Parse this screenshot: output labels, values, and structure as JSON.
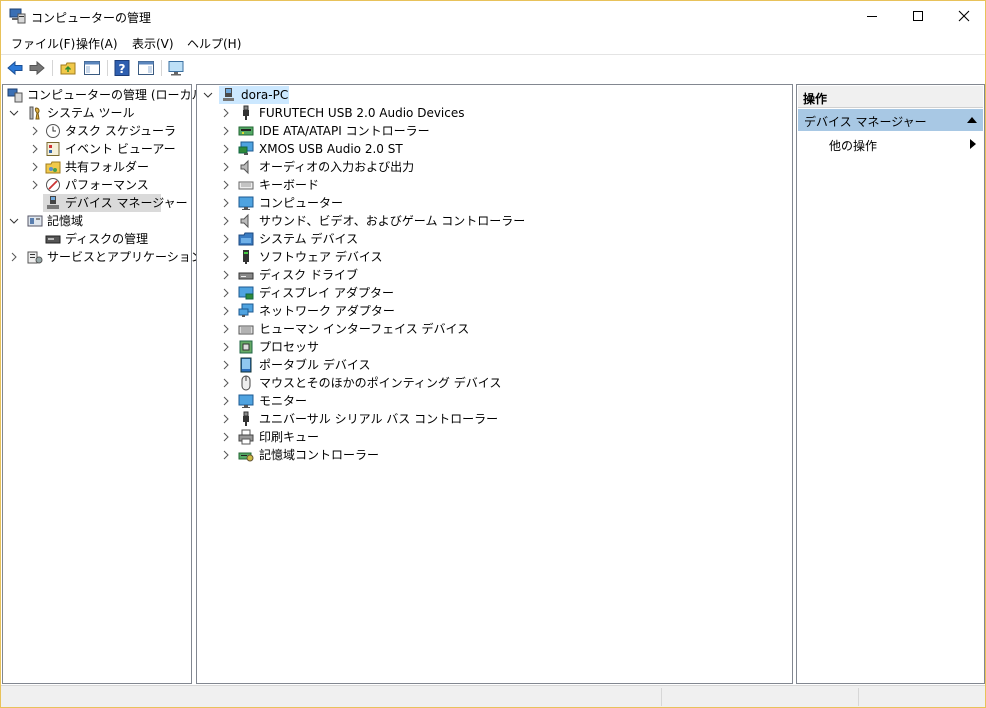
{
  "window": {
    "title": "コンピューターの管理"
  },
  "menu": [
    "ファイル(F)",
    "操作(A)",
    "表示(V)",
    "ヘルプ(H)"
  ],
  "left_tree": [
    {
      "label": "コンピューターの管理 (ローカル)",
      "icon": "computer-management-icon",
      "level": 0,
      "expander": "none"
    },
    {
      "label": "システム ツール",
      "icon": "system-tools-icon",
      "level": 1,
      "expander": "expanded"
    },
    {
      "label": "タスク スケジューラ",
      "icon": "clock-icon",
      "level": 2,
      "expander": "collapsed"
    },
    {
      "label": "イベント ビューアー",
      "icon": "event-viewer-icon",
      "level": 2,
      "expander": "collapsed"
    },
    {
      "label": "共有フォルダー",
      "icon": "shared-folder-icon",
      "level": 2,
      "expander": "collapsed"
    },
    {
      "label": "パフォーマンス",
      "icon": "performance-icon",
      "level": 2,
      "expander": "collapsed"
    },
    {
      "label": "デバイス マネージャー",
      "icon": "device-manager-icon",
      "level": 2,
      "expander": "none",
      "selected": true
    },
    {
      "label": "記憶域",
      "icon": "storage-icon",
      "level": 1,
      "expander": "expanded"
    },
    {
      "label": "ディスクの管理",
      "icon": "disk-management-icon",
      "level": 2,
      "expander": "none"
    },
    {
      "label": "サービスとアプリケーション",
      "icon": "services-icon",
      "level": 1,
      "expander": "collapsed"
    }
  ],
  "device_tree": {
    "root": "dora-PC",
    "items": [
      {
        "label": "FURUTECH USB 2.0 Audio Devices",
        "icon": "usb-plug-icon"
      },
      {
        "label": "IDE ATA/ATAPI コントローラー",
        "icon": "ide-controller-icon"
      },
      {
        "label": "XMOS USB Audio 2.0 ST",
        "icon": "monitor-network-icon"
      },
      {
        "label": "オーディオの入力および出力",
        "icon": "speaker-icon"
      },
      {
        "label": "キーボード",
        "icon": "keyboard-icon"
      },
      {
        "label": "コンピューター",
        "icon": "monitor-icon"
      },
      {
        "label": "サウンド、ビデオ、およびゲーム コントローラー",
        "icon": "speaker-icon"
      },
      {
        "label": "システム デバイス",
        "icon": "system-folder-icon"
      },
      {
        "label": "ソフトウェア デバイス",
        "icon": "software-device-icon"
      },
      {
        "label": "ディスク ドライブ",
        "icon": "disk-drive-icon"
      },
      {
        "label": "ディスプレイ アダプター",
        "icon": "display-adapter-icon"
      },
      {
        "label": "ネットワーク アダプター",
        "icon": "network-adapter-icon"
      },
      {
        "label": "ヒューマン インターフェイス デバイス",
        "icon": "hid-icon"
      },
      {
        "label": "プロセッサ",
        "icon": "processor-icon"
      },
      {
        "label": "ポータブル デバイス",
        "icon": "portable-device-icon"
      },
      {
        "label": "マウスとそのほかのポインティング デバイス",
        "icon": "mouse-icon"
      },
      {
        "label": "モニター",
        "icon": "monitor-icon"
      },
      {
        "label": "ユニバーサル シリアル バス コントローラー",
        "icon": "usb-plug-icon"
      },
      {
        "label": "印刷キュー",
        "icon": "printer-icon"
      },
      {
        "label": "記憶域コントローラー",
        "icon": "storage-controller-icon"
      }
    ]
  },
  "actions": {
    "header": "操作",
    "section": "デバイス マネージャー",
    "item": "他の操作"
  },
  "colors": {
    "selection": "#a8c8e4",
    "tree_selected": "#cce8ff",
    "border": "#828790"
  }
}
